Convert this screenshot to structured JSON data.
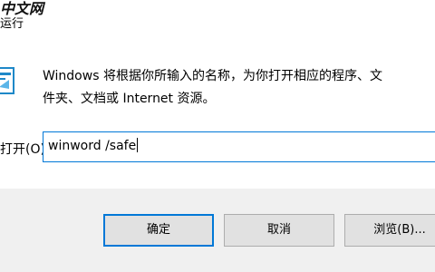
{
  "window": {
    "watermark": "中文网",
    "title": "运行"
  },
  "icons": {
    "run": "run-icon"
  },
  "description": {
    "line1": "Windows 将根据你所输入的名称，为你打开相应的程序、文",
    "line2": "件夹、文档或 Internet 资源。"
  },
  "open_field": {
    "label": "打开(O):",
    "value": "winword /safe"
  },
  "buttons": {
    "ok": "确定",
    "cancel": "取消",
    "browse": "浏览(B)..."
  },
  "colors": {
    "accent": "#0078d7",
    "footer_bg": "#f0f0f0",
    "button_bg": "#e1e1e1"
  }
}
